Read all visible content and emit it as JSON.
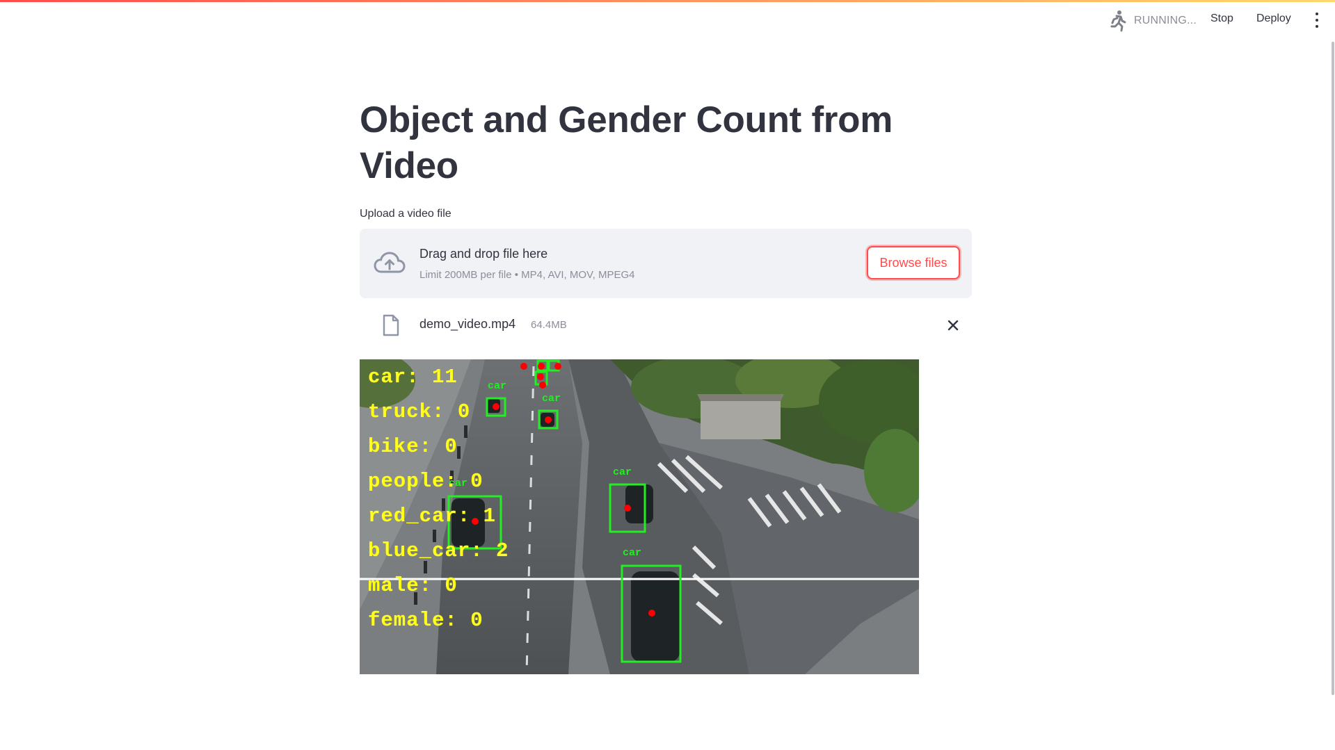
{
  "header": {
    "status_text": "RUNNING...",
    "stop_label": "Stop",
    "deploy_label": "Deploy",
    "accent_color": "#ff4b4b"
  },
  "main": {
    "title": "Object and Gender Count from Video",
    "uploader": {
      "label": "Upload a video file",
      "drop_title": "Drag and drop file here",
      "drop_subtitle": "Limit 200MB per file • MP4, AVI, MOV, MPEG4",
      "browse_label": "Browse files",
      "icon": "cloud-upload-icon"
    },
    "file": {
      "name": "demo_video.mp4",
      "size": "64.4MB",
      "icon": "file-icon",
      "remove_icon": "close-icon"
    },
    "video": {
      "overlay_counts": [
        "car: 11",
        "truck: 0",
        "bike: 0",
        "people: 0",
        "red_car: 1",
        "blue_car: 2",
        "male: 0",
        "female: 0"
      ],
      "detection_label": "car",
      "overlay_color": "#ffff1a",
      "box_color": "#22ee22",
      "point_color": "#ff0000"
    }
  }
}
